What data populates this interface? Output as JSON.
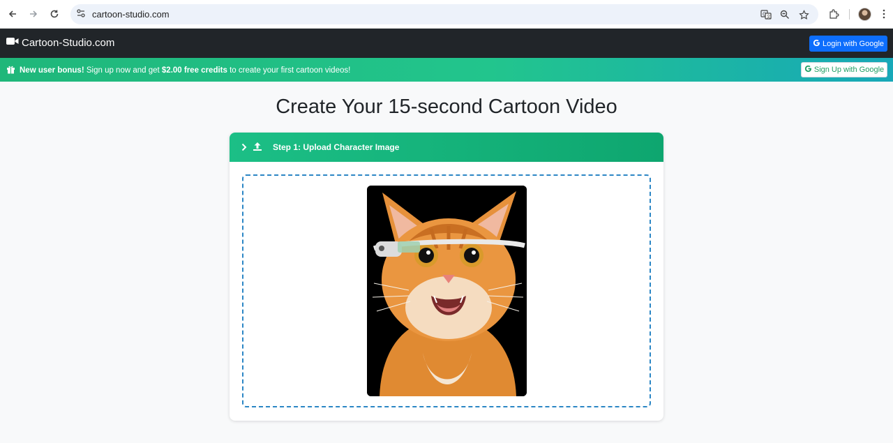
{
  "browser": {
    "url": "cartoon-studio.com",
    "icons": [
      "back-arrow-icon",
      "forward-arrow-icon",
      "reload-icon",
      "site-settings-icon",
      "translate-icon",
      "zoom-icon",
      "bookmark-star-icon",
      "extensions-icon",
      "profile-avatar",
      "more-menu-icon"
    ]
  },
  "navbar": {
    "brand": "Cartoon-Studio.com",
    "brand_icon": "video-camera-icon",
    "login_label": "Login with Google",
    "login_color": "#0d6efd",
    "bg_color": "#212529"
  },
  "promo": {
    "lead": "New user bonus!",
    "text1": " Sign up now and get ",
    "credits": "$2.00 free credits",
    "text2": " to create your first cartoon videos!",
    "signup_label": "Sign Up with Google",
    "icon": "gift-icon"
  },
  "main": {
    "title": "Create Your 15-second Cartoon Video",
    "step": {
      "label": "Step 1: Upload Character Image",
      "icons": [
        "chevron-right-icon",
        "upload-icon"
      ],
      "color": "#10b07a"
    },
    "dropzone": {
      "preview_alt": "orange cat wearing smart glasses",
      "border_color": "#2b86c5"
    }
  }
}
